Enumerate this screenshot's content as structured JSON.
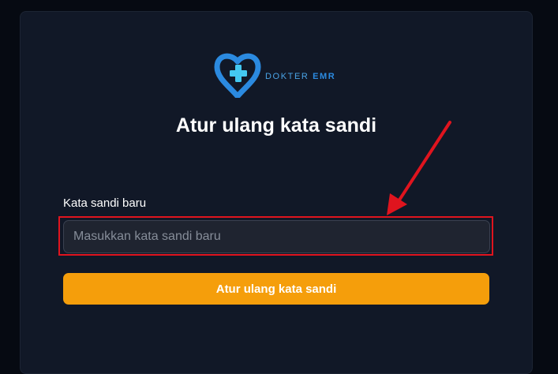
{
  "brand": {
    "name_part1": "DOKTER ",
    "name_part2": "EMR"
  },
  "page_title": "Atur ulang kata sandi",
  "form": {
    "password_label": "Kata sandi baru",
    "password_placeholder": "Masukkan kata sandi baru",
    "submit_label": "Atur ulang kata sandi"
  },
  "colors": {
    "background": "#060a12",
    "card": "#111827",
    "accent_button": "#f59e0b",
    "highlight_box": "#e0141e",
    "annotation_arrow": "#e0141e",
    "logo_blue": "#2b8ae0"
  },
  "icons": {
    "logo": "heart-cross-logo-icon",
    "annotation": "red-arrow-icon"
  }
}
